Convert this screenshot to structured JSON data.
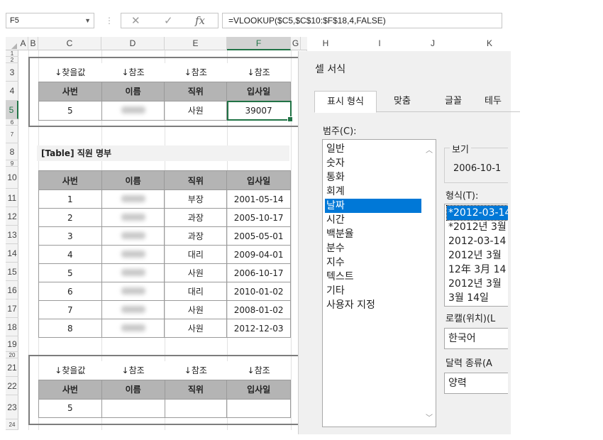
{
  "formula_bar": {
    "name_box": "F5",
    "cancel_icon": "✕",
    "enter_icon": "✓",
    "fx_icon": "fx",
    "formula": "=VLOOKUP($C5,$C$10:$F$18,4,FALSE)"
  },
  "columns": [
    "A",
    "B",
    "C",
    "D",
    "E",
    "F",
    "G",
    "H",
    "I",
    "J",
    "K"
  ],
  "rows": [
    "1",
    "2",
    "3",
    "4",
    "5",
    "6",
    "7",
    "8",
    "9",
    "10",
    "11",
    "12",
    "13",
    "14",
    "15",
    "16",
    "17",
    "18",
    "19",
    "20",
    "21",
    "22",
    "23",
    "24"
  ],
  "ref_labels": [
    "↓찾을값",
    "↓참조",
    "↓참조",
    "↓참조"
  ],
  "headers": [
    "사번",
    "이름",
    "직위",
    "입사일"
  ],
  "lookup1": {
    "id": "5",
    "name": "",
    "title": "사원",
    "date": "39007"
  },
  "table_title": "[Table] 직원 명부",
  "employees": [
    {
      "id": "1",
      "title": "부장",
      "date": "2001-05-14"
    },
    {
      "id": "2",
      "title": "과장",
      "date": "2005-10-17"
    },
    {
      "id": "3",
      "title": "과장",
      "date": "2005-05-01"
    },
    {
      "id": "4",
      "title": "대리",
      "date": "2009-04-01"
    },
    {
      "id": "5",
      "title": "사원",
      "date": "2006-10-17"
    },
    {
      "id": "6",
      "title": "대리",
      "date": "2010-01-02"
    },
    {
      "id": "7",
      "title": "사원",
      "date": "2008-01-02"
    },
    {
      "id": "8",
      "title": "사원",
      "date": "2012-12-03"
    }
  ],
  "lookup2": {
    "id": "5"
  },
  "dialog": {
    "title": "셀 서식",
    "tabs": [
      "표시 형식",
      "맞춤",
      "글꼴",
      "테두"
    ],
    "category_label": "범주(C):",
    "categories": [
      "일반",
      "숫자",
      "통화",
      "회계",
      "날짜",
      "시간",
      "백분율",
      "분수",
      "지수",
      "텍스트",
      "기타",
      "사용자 지정"
    ],
    "selected_category": "날짜",
    "sample_label": "보기",
    "sample_value": "2006-10-1",
    "format_label": "형식(T):",
    "formats": [
      "*2012-03-14",
      "*2012년 3월",
      "2012-03-14",
      "2012년 3월",
      "12年 3月 14",
      "2012년 3월",
      "3월 14일"
    ],
    "locale_label": "로캘(위치)(L",
    "locale_value": "한국어",
    "calendar_label": "달력 종류(A",
    "calendar_value": "양력"
  },
  "colors": {
    "excel_green": "#217346",
    "header_gray": "#b4b4b4",
    "selection_blue": "#0078d7"
  }
}
